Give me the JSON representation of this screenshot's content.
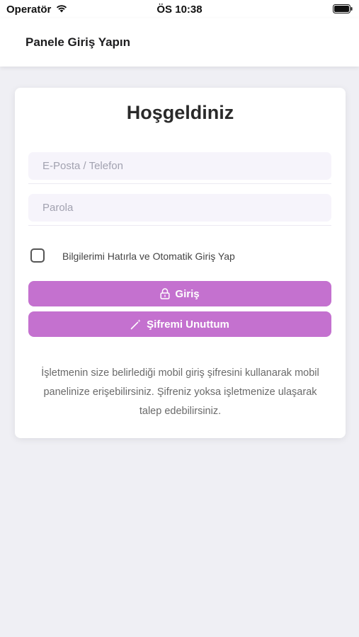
{
  "status_bar": {
    "carrier": "Operatör",
    "time": "ÖS 10:38",
    "wifi_icon": "wifi-icon",
    "battery_icon": "battery-icon"
  },
  "nav": {
    "title": "Panele Giriş Yapın"
  },
  "login": {
    "heading": "Hoşgeldiniz",
    "email_placeholder": "E-Posta / Telefon",
    "email_value": "",
    "password_placeholder": "Parola",
    "password_value": "",
    "remember_label": "Bilgilerimi Hatırla ve Otomatik Giriş Yap",
    "remember_checked": false,
    "login_button": "Giriş",
    "login_icon": "lock-icon",
    "forgot_button": "Şifremi Unuttum",
    "forgot_icon": "magic-wand-icon",
    "info_text": "İşletmenin size belirlediği mobil giriş şifresini kullanarak mobil panelinize erişebilirsiniz. Şifreniz yoksa işletmenize ulaşarak talep edebilirsiniz."
  },
  "colors": {
    "accent": "#c471cf",
    "background": "#efeff4",
    "input_background": "#f6f4fb"
  }
}
